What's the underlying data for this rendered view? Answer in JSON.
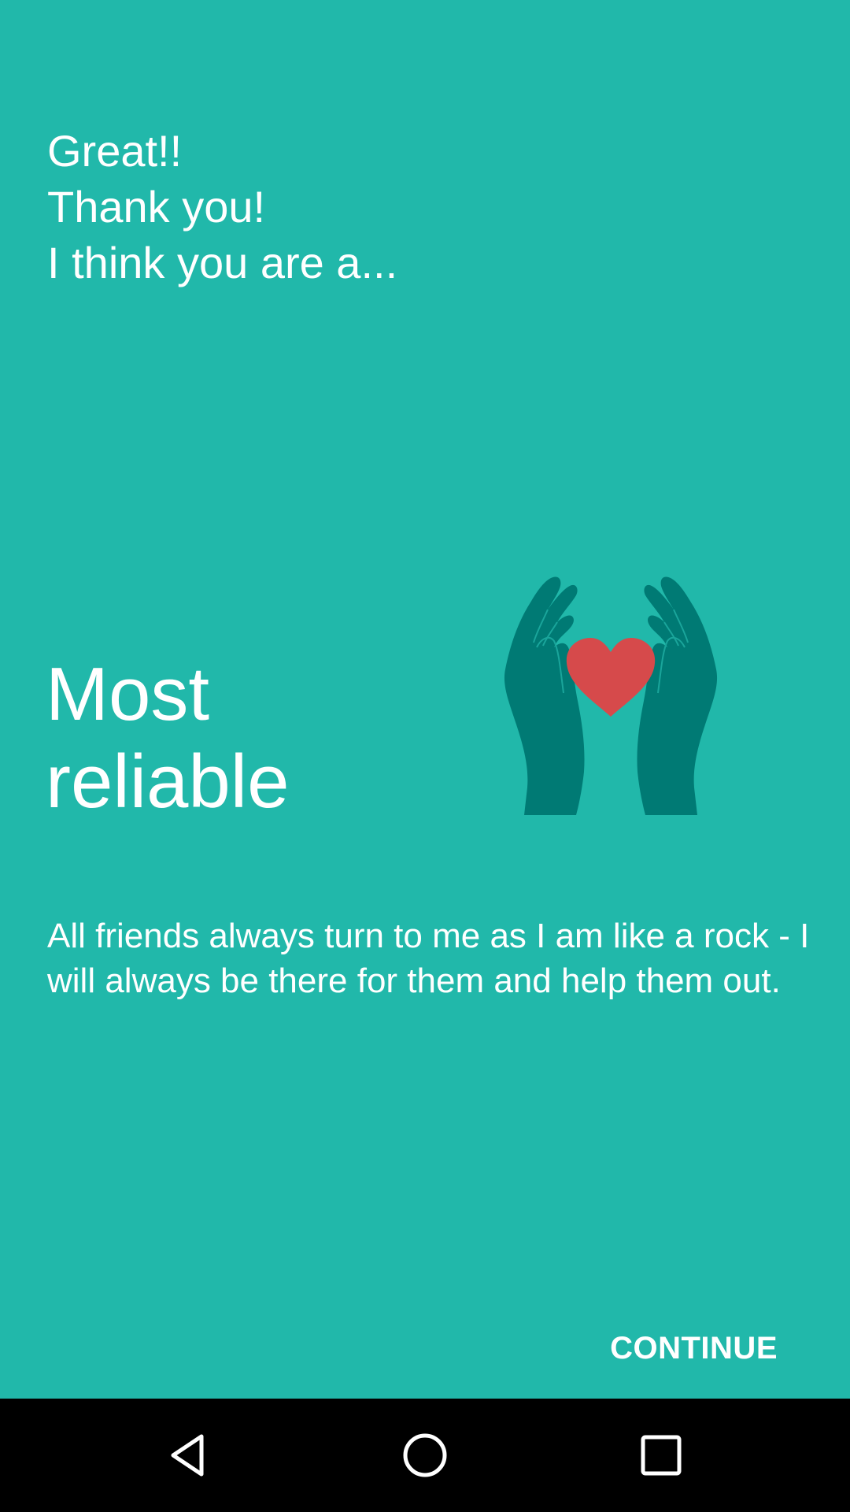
{
  "greeting": {
    "line1": "Great!!",
    "line2": "Thank you!",
    "line3": "I think you are a..."
  },
  "result": {
    "title_line1": "Most",
    "title_line2": "reliable",
    "description": "All friends always turn to me as I am like a rock - I will always be there for them and help them out.",
    "illustration_icon": "hands-holding-heart-icon"
  },
  "actions": {
    "continue_label": "CONTINUE"
  },
  "nav": {
    "back_icon": "back-triangle-icon",
    "home_icon": "home-circle-icon",
    "recent_icon": "recents-square-icon"
  },
  "colors": {
    "background": "#21b8aa",
    "hands": "#007a74",
    "heart": "#d64a4b",
    "navbar": "#000000"
  }
}
